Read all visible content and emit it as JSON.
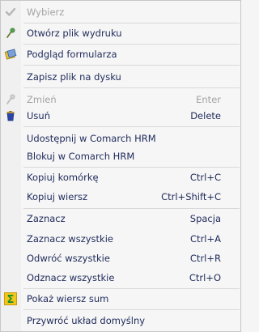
{
  "menu": {
    "items": [
      {
        "label": "Wybierz",
        "shortcut": "",
        "icon": "checkmark-icon"
      },
      {
        "label": "Otwórz plik wydruku",
        "shortcut": "",
        "icon": "pin-icon"
      },
      {
        "label": "Podgląd formularza",
        "shortcut": "",
        "icon": "preview-form-icon"
      },
      {
        "label": "Zapisz plik na dysku",
        "shortcut": "",
        "icon": ""
      },
      {
        "label": "Zmień",
        "shortcut": "Enter",
        "icon": "edit-icon"
      },
      {
        "label": "Usuń",
        "shortcut": "Delete",
        "icon": "trash-icon"
      },
      {
        "label": "Udostępnij w Comarch HRM",
        "shortcut": "",
        "icon": ""
      },
      {
        "label": "Blokuj w Comarch HRM",
        "shortcut": "",
        "icon": ""
      },
      {
        "label": "Kopiuj komórkę",
        "shortcut": "Ctrl+C",
        "icon": ""
      },
      {
        "label": "Kopiuj wiersz",
        "shortcut": "Ctrl+Shift+C",
        "icon": ""
      },
      {
        "label": "Zaznacz",
        "shortcut": "Spacja",
        "icon": ""
      },
      {
        "label": "Zaznacz wszystkie",
        "shortcut": "Ctrl+A",
        "icon": ""
      },
      {
        "label": "Odwróć wszystkie",
        "shortcut": "Ctrl+R",
        "icon": ""
      },
      {
        "label": "Odznacz wszystkie",
        "shortcut": "Ctrl+O",
        "icon": ""
      },
      {
        "label": "Pokaż wiersz sum",
        "shortcut": "",
        "icon": "sum-icon"
      },
      {
        "label": "Przywróć układ domyślny",
        "shortcut": "",
        "icon": ""
      }
    ]
  },
  "colors": {
    "text": "#1e2a5a",
    "disabled_text": "#a3a3a3",
    "sum_icon_bg": "#f3c61c",
    "sum_icon_fg": "#1a8f2a"
  }
}
